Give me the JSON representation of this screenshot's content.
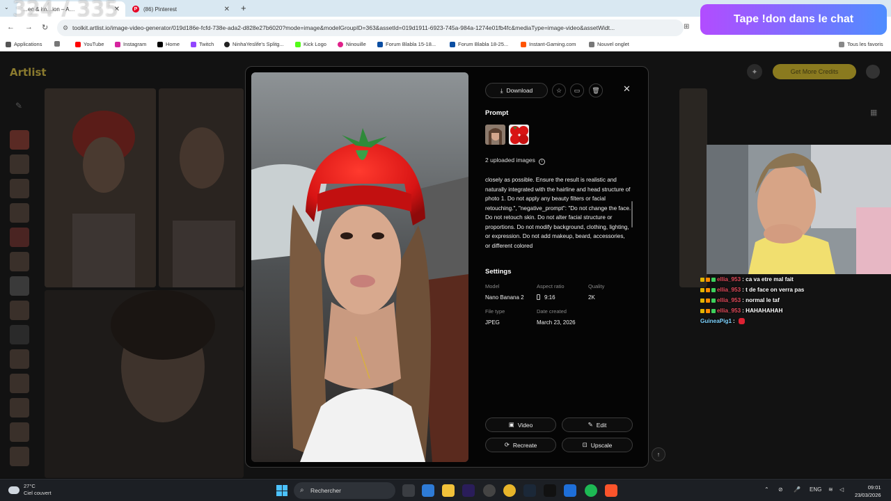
{
  "overlay": {
    "counter": "324 / 335",
    "donation_banner": "Tape !don dans le chat"
  },
  "browser": {
    "tabs": [
      {
        "title": "…eo & im…ion – A…",
        "active": true
      },
      {
        "title": "(86) Pinterest",
        "active": false
      }
    ],
    "url": "toolkit.artlist.io/image-video-generator/019d186e-fcfd-738e-ada2-d828e27b6020?mode=image&modelGroupID=363&assetId=019d1911-6923-745a-984a-1274e01fb4fc&mediaType=image-video&assetWidt...",
    "bookmarks": [
      {
        "label": "Applications",
        "color": "#555555"
      },
      {
        "label": "YouTube",
        "color": "#ff0000"
      },
      {
        "label": "Instagram",
        "color": "#d6249f"
      },
      {
        "label": "Home",
        "color": "#000000"
      },
      {
        "label": "Twitch",
        "color": "#9146ff"
      },
      {
        "label": "NinhaYeslife's Splitg...",
        "color": "#222222"
      },
      {
        "label": "Kick Logo",
        "color": "#53fc18"
      },
      {
        "label": "Ninouille",
        "color": "#e0218a"
      },
      {
        "label": "Forum Blabla 15-18...",
        "color": "#0b4ea2"
      },
      {
        "label": "Forum Blabla 18-25...",
        "color": "#0b4ea2"
      },
      {
        "label": "Instant-Gaming.com",
        "color": "#ff5400"
      },
      {
        "label": "Nouvel onglet",
        "color": "#777777"
      }
    ],
    "all_bookmarks": "Tous les favoris"
  },
  "app": {
    "logo": "Artlist",
    "credits_button": "Get More Credits"
  },
  "modal": {
    "download_label": "Download",
    "prompt_heading": "Prompt",
    "uploaded_images": "2 uploaded images",
    "prompt_text": "closely as possible. Ensure the result is realistic and naturally integrated with the hairline and head structure of photo 1. Do not apply any beauty filters or facial retouching.\", \"negative_prompt\": \"Do not change the face. Do not retouch skin. Do not alter facial structure or proportions. Do not modify background, clothing, lighting, or expression. Do not add makeup, beard, accessories, or different colored",
    "settings_heading": "Settings",
    "settings": {
      "model_label": "Model",
      "model_value": "Nano Banana 2",
      "aspect_label": "Aspect ratio",
      "aspect_value": "9:16",
      "quality_label": "Quality",
      "quality_value": "2K",
      "filetype_label": "File type",
      "filetype_value": "JPEG",
      "date_label": "Date created",
      "date_value": "March 23, 2026"
    },
    "actions": {
      "video": "Video",
      "edit": "Edit",
      "recreate": "Recreate",
      "upscale": "Upscale"
    }
  },
  "chat": [
    {
      "user": "ellia_953",
      "msg": ": ca va etre mal fait",
      "kind": "sub"
    },
    {
      "user": "ellia_953",
      "msg": ": t de face on verra pas",
      "kind": "sub"
    },
    {
      "user": "ellia_953",
      "msg": ": normal le taf",
      "kind": "sub"
    },
    {
      "user": "ellia_953",
      "msg": ": HAHAHAHAH",
      "kind": "sub"
    },
    {
      "user": "GuineaPig1",
      "msg": ":",
      "kind": "plain"
    }
  ],
  "taskbar": {
    "weather_temp": "27°C",
    "weather_desc": "Ciel couvert",
    "search_placeholder": "Rechercher",
    "lang": "ENG",
    "time": "09:01",
    "date": "23/03/2026"
  }
}
